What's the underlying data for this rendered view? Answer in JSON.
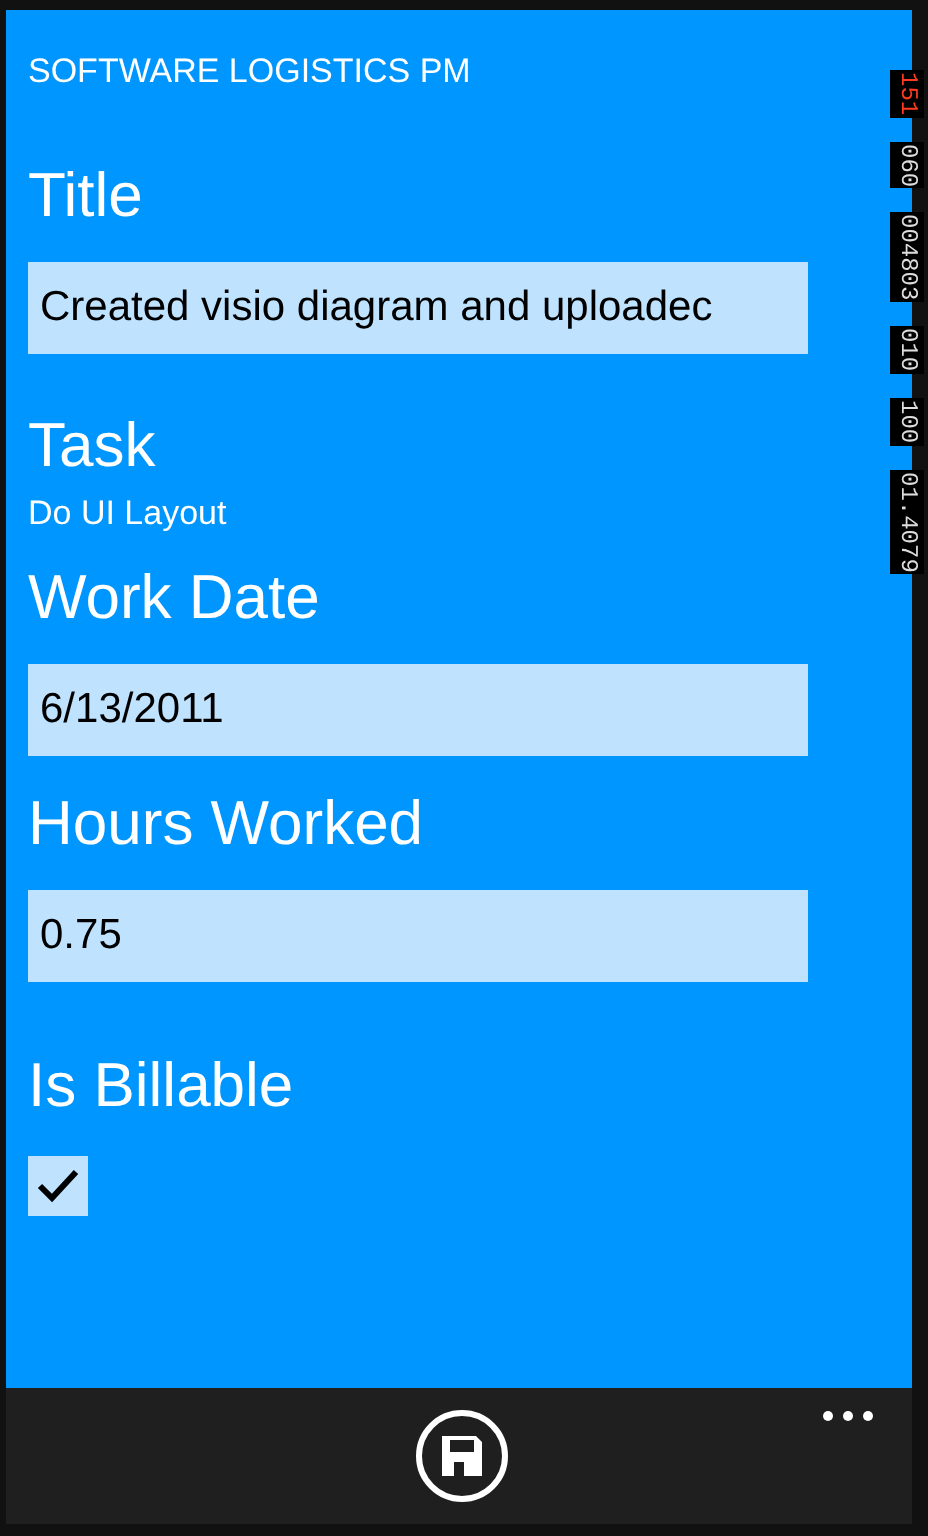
{
  "app_title": "SOFTWARE LOGISTICS PM",
  "fields": [
    {
      "kind": "input",
      "label": "Title",
      "value": "Created visio diagram and uploadec"
    },
    {
      "kind": "text",
      "label": "Task",
      "value": "Do UI Layout"
    },
    {
      "kind": "input",
      "label": "Work Date",
      "value": "6/13/2011"
    },
    {
      "kind": "input",
      "label": "Hours Worked",
      "value": "0.75"
    },
    {
      "kind": "checkbox",
      "label": "Is Billable",
      "checked": true
    }
  ],
  "frame_counters": [
    "151",
    "060",
    "004803",
    "010",
    "100",
    "01.4079"
  ]
}
